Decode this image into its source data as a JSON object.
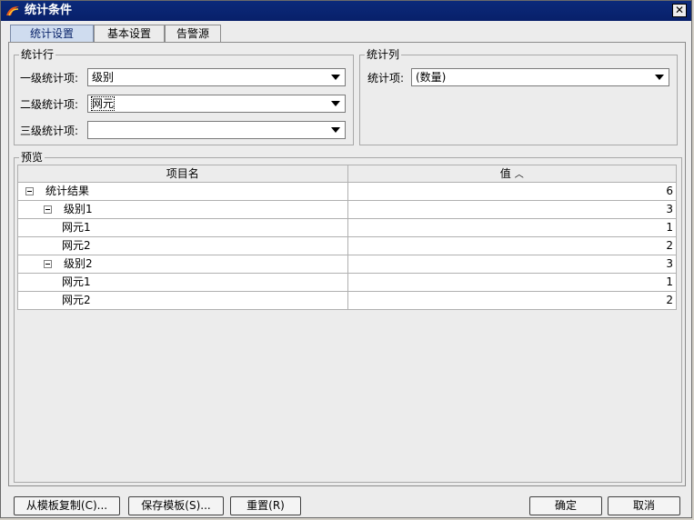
{
  "window": {
    "title": "统计条件"
  },
  "tabs": [
    {
      "label": "统计设置",
      "active": true
    },
    {
      "label": "基本设置",
      "active": false
    },
    {
      "label": "告警源",
      "active": false
    }
  ],
  "stat_row": {
    "group_label": "统计行",
    "level1": {
      "label": "一级统计项:",
      "value": "级别"
    },
    "level2": {
      "label": "二级统计项:",
      "value": "网元"
    },
    "level3": {
      "label": "三级统计项:",
      "value": ""
    }
  },
  "stat_col": {
    "group_label": "统计列",
    "item": {
      "label": "统计项:",
      "value": "(数量)"
    }
  },
  "preview": {
    "group_label": "预览",
    "headers": {
      "name": "项目名",
      "value": "值",
      "sort_glyph": "︿"
    },
    "rows": [
      {
        "name": "统计结果",
        "value": "6",
        "level": 0,
        "expander": true
      },
      {
        "name": "级别1",
        "value": "3",
        "level": 1,
        "expander": true
      },
      {
        "name": "网元1",
        "value": "1",
        "level": 2,
        "expander": false
      },
      {
        "name": "网元2",
        "value": "2",
        "level": 2,
        "expander": false
      },
      {
        "name": "级别2",
        "value": "3",
        "level": 1,
        "expander": true
      },
      {
        "name": "网元1",
        "value": "1",
        "level": 2,
        "expander": false
      },
      {
        "name": "网元2",
        "value": "2",
        "level": 2,
        "expander": false
      }
    ]
  },
  "buttons": {
    "copy_template": "从模板复制(C)...",
    "save_template": "保存模板(S)...",
    "reset": "重置(R)",
    "ok": "确定",
    "cancel": "取消"
  },
  "colors": {
    "titlebar": "#0a246a",
    "active_tab": "#cfdcef"
  },
  "icons": {
    "app": "app-logo-icon",
    "close": "close-icon",
    "dropdown": "chevron-down-icon",
    "collapse": "collapse-icon"
  }
}
